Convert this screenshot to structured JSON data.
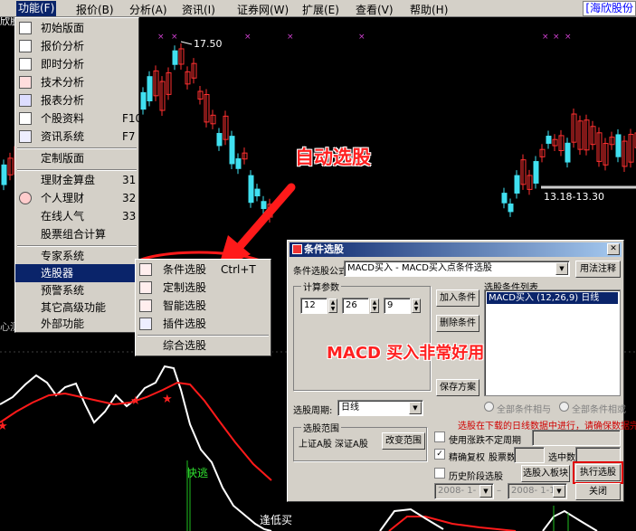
{
  "menubar": {
    "items": [
      "功能(F)",
      "报价(B)",
      "分析(A)",
      "资讯(I)",
      "证券网(W)",
      "扩展(E)",
      "查看(V)",
      "帮助(H)"
    ],
    "right_title": "[海欣股份"
  },
  "chart": {
    "price_high_label": "17.50",
    "range_label": "13.18-13.30",
    "left_text": "欣股",
    "bottom_left_fragment": "心测",
    "signal_fast_escape": "快逃",
    "signal_low_buy": "逢低买"
  },
  "main_menu": {
    "items": [
      {
        "label": "初始版面",
        "key": ""
      },
      {
        "label": "报价分析",
        "key": ""
      },
      {
        "label": "即时分析",
        "key": ""
      },
      {
        "label": "技术分析",
        "key": ""
      },
      {
        "label": "报表分析",
        "key": ""
      },
      {
        "label": "个股资料",
        "key": "F10"
      },
      {
        "label": "资讯系统",
        "key": "F7"
      },
      {
        "label": "定制版面",
        "key": ""
      },
      {
        "label": "理财金算盘",
        "key": "31"
      },
      {
        "label": "个人理财",
        "key": "32"
      },
      {
        "label": "在线人气",
        "key": "33"
      },
      {
        "label": "股票组合计算",
        "key": ""
      },
      {
        "label": "专家系统",
        "key": ""
      },
      {
        "label": "选股器",
        "key": ""
      },
      {
        "label": "预警系统",
        "key": ""
      },
      {
        "label": "其它高级功能",
        "key": ""
      },
      {
        "label": "外部功能",
        "key": ""
      }
    ]
  },
  "sub_menu": {
    "items": [
      {
        "label": "条件选股",
        "key": "Ctrl+T"
      },
      {
        "label": "定制选股",
        "key": ""
      },
      {
        "label": "智能选股",
        "key": ""
      },
      {
        "label": "插件选股",
        "key": ""
      },
      {
        "label": "综合选股",
        "key": ""
      }
    ]
  },
  "annotations": {
    "auto_select": "自动选股",
    "macd_note": "MACD 买入非常好用"
  },
  "colors": {
    "annotation_red": "#ff2020",
    "menu_highlight": "#0a246a",
    "candle_up": "#ff3030",
    "candle_down": "#40e0f0"
  },
  "dialog": {
    "title": "条件选股",
    "formula_label": "条件选股公式",
    "formula_value": "MACD买入 - MACD买入点条件选股",
    "usage_button": "用法注释",
    "params_group": "计算参数",
    "param1": "12",
    "param2": "26",
    "param3": "9",
    "list_label": "选股条件列表",
    "list_selected": "MACD买入 (12,26,9) 日线",
    "add_condition": "加入条件",
    "delete_condition": "删除条件",
    "save_plan": "保存方案",
    "radio_all_or": "全部条件相与",
    "radio_all_and": "全部条件相或",
    "period_label": "选股周期:",
    "period_value": "日线",
    "scope_group": "选股范围",
    "scope_value": "上证A股 深证A股",
    "change_scope": "改变范围",
    "red_note": "选股在下载的日线数据中进行，请确保数据完整",
    "use_prescreen": "使用涨跌不定周期",
    "precise_adjust": "精确复权",
    "stock_count_label": "股票数",
    "selected_count_label": "选中数",
    "history_period": "历史阶段选股",
    "select_into_block": "选股入板块",
    "execute": "执行选股",
    "close": "关闭",
    "date_from": "2008- 1- 8",
    "date_to": "2008- 1-15"
  }
}
